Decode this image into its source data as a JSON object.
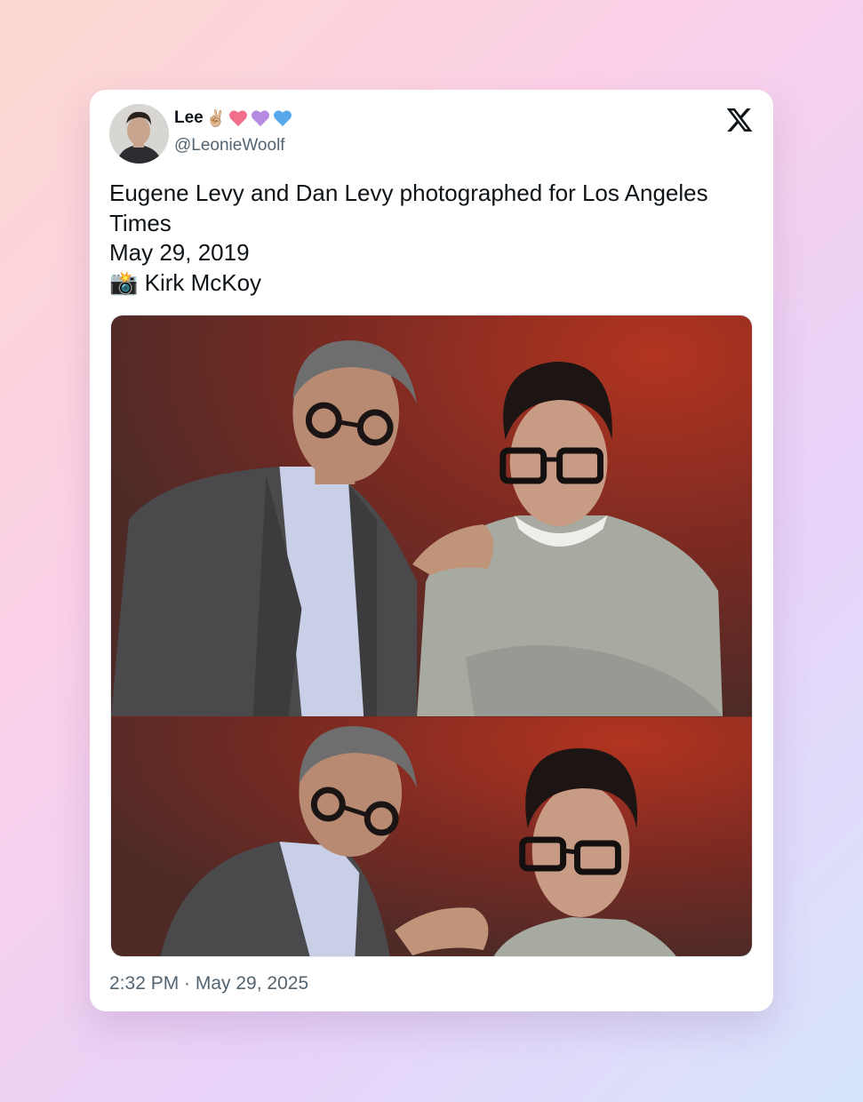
{
  "tweet": {
    "author_name": "Lee",
    "handle": "@LeonieWoolf",
    "name_emoji": "✌🏼",
    "hearts": [
      {
        "name": "pink-heart",
        "color": "#f0708c"
      },
      {
        "name": "purple-heart",
        "color": "#b48be0"
      },
      {
        "name": "blue-heart",
        "color": "#5aa8ec"
      }
    ],
    "text_lines": [
      "Eugene Levy and Dan Levy photographed for Los Angeles Times",
      "May 29, 2019",
      "📸 Kirk McKoy"
    ],
    "timestamp": "2:32 PM · May 29, 2025",
    "platform_icon": "x-logo-icon"
  },
  "media": {
    "photos": [
      {
        "name": "photo-top",
        "description_icon": "photo"
      },
      {
        "name": "photo-bottom",
        "description_icon": "photo"
      }
    ]
  },
  "colors": {
    "background_start": "#fcd7cf",
    "background_end": "#d6e4fb",
    "card": "#ffffff",
    "text_primary": "#0f1419",
    "text_secondary": "#536471",
    "photo_backdrop": "#7a2a22"
  }
}
